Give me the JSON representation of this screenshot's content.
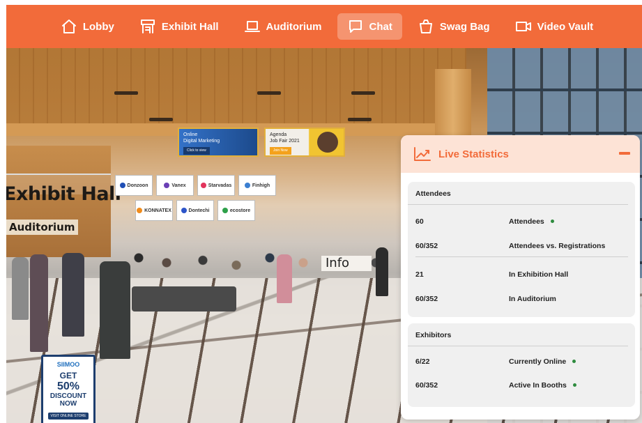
{
  "nav": {
    "items": [
      {
        "label": "Lobby",
        "icon": "home-icon",
        "active": false
      },
      {
        "label": "Exhibit Hall",
        "icon": "booth-icon",
        "active": false
      },
      {
        "label": "Auditorium",
        "icon": "laptop-icon",
        "active": false
      },
      {
        "label": "Chat",
        "icon": "chat-icon",
        "active": true
      },
      {
        "label": "Swag Bag",
        "icon": "bag-icon",
        "active": false
      },
      {
        "label": "Video Vault",
        "icon": "video-icon",
        "active": false
      }
    ],
    "color": "#f26b3a"
  },
  "scene": {
    "hall_sign": "Exhibit Hall",
    "auditorium_sign": "Auditorium",
    "info_desk": "Info",
    "banners": [
      {
        "line1": "Online",
        "line2": "Digital Marketing",
        "button": "Click to view"
      },
      {
        "line1": "Agenda",
        "line2": "Job Fair 2021",
        "button": "Join Now"
      }
    ],
    "sponsors_row1": [
      "Donzoon",
      "Vanex",
      "Starvadas",
      "Finhigh"
    ],
    "sponsors_row2": [
      "KONNATEX",
      "Dontechi",
      "ecostore"
    ],
    "promo": {
      "brand": "SIIMOO",
      "line1": "GET",
      "line2": "50%",
      "line3": "DISCOUNT",
      "line4": "NOW",
      "cta": "VISIT ONLINE STORE"
    }
  },
  "stats": {
    "title": "Live Statistics",
    "accent": "#f26b3a",
    "online_color": "#2e8b3e",
    "attendees": {
      "heading": "Attendees",
      "rows": [
        {
          "value": "60",
          "label": "Attendees",
          "online": true
        },
        {
          "value": "60/352",
          "label": "Attendees vs. Registrations",
          "online": false
        },
        {
          "value": "21",
          "label": "In Exhibition Hall",
          "online": false
        },
        {
          "value": "60/352",
          "label": "In Auditorium",
          "online": false
        }
      ]
    },
    "exhibitors": {
      "heading": "Exhibitors",
      "rows": [
        {
          "value": "6/22",
          "label": "Currently Online",
          "online": true
        },
        {
          "value": "60/352",
          "label": "Active In Booths",
          "online": true
        }
      ]
    }
  }
}
